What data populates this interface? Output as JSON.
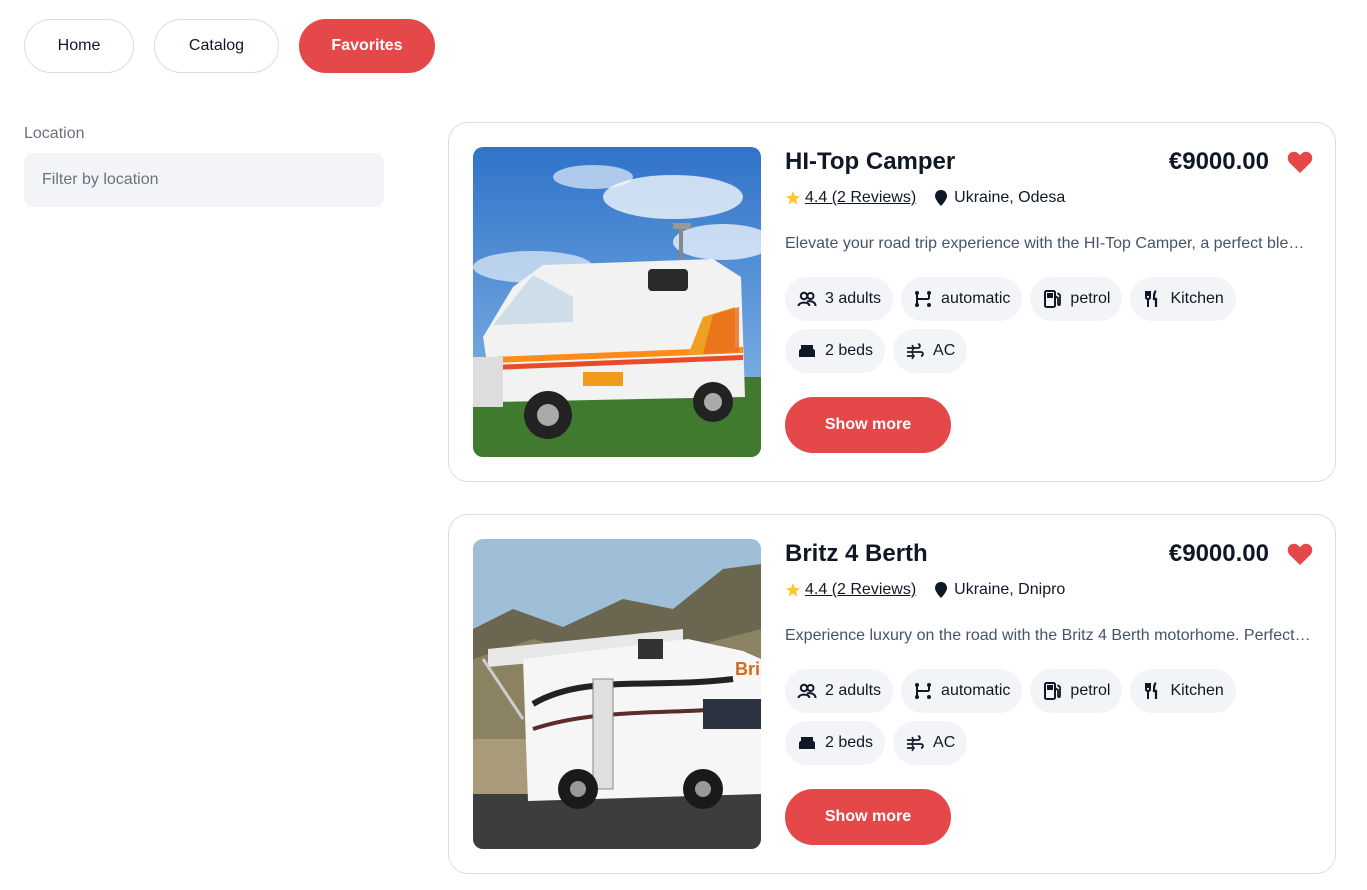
{
  "nav": {
    "home": "Home",
    "catalog": "Catalog",
    "favorites": "Favorites"
  },
  "filter": {
    "label": "Location",
    "placeholder": "Filter by location"
  },
  "colors": {
    "accent": "#e44848",
    "star": "#ffc531",
    "chip_bg": "#f2f4f7"
  },
  "campers": [
    {
      "name": "HI-Top Camper",
      "price": "€9000.00",
      "rating": "4.4 (2 Reviews)",
      "location": "Ukraine, Odesa",
      "description": "Elevate your road trip experience with the HI-Top Camper, a perfect blend of comfort and convenience.",
      "favorite": true,
      "features": [
        {
          "icon": "users-icon",
          "label": "3 adults"
        },
        {
          "icon": "transmission-icon",
          "label": "automatic"
        },
        {
          "icon": "fuel-pump-icon",
          "label": "petrol"
        },
        {
          "icon": "kitchen-icon",
          "label": "Kitchen"
        },
        {
          "icon": "bed-icon",
          "label": "2 beds"
        },
        {
          "icon": "air-conditioner-icon",
          "label": "AC"
        }
      ],
      "button": "Show more"
    },
    {
      "name": "Britz 4 Berth",
      "price": "€9000.00",
      "rating": "4.4 (2 Reviews)",
      "location": "Ukraine, Dnipro",
      "description": "Experience luxury on the road with the Britz 4 Berth motorhome. Perfect for families and groups.",
      "favorite": true,
      "features": [
        {
          "icon": "users-icon",
          "label": "2 adults"
        },
        {
          "icon": "transmission-icon",
          "label": "automatic"
        },
        {
          "icon": "fuel-pump-icon",
          "label": "petrol"
        },
        {
          "icon": "kitchen-icon",
          "label": "Kitchen"
        },
        {
          "icon": "bed-icon",
          "label": "2 beds"
        },
        {
          "icon": "air-conditioner-icon",
          "label": "AC"
        }
      ],
      "button": "Show more"
    }
  ]
}
